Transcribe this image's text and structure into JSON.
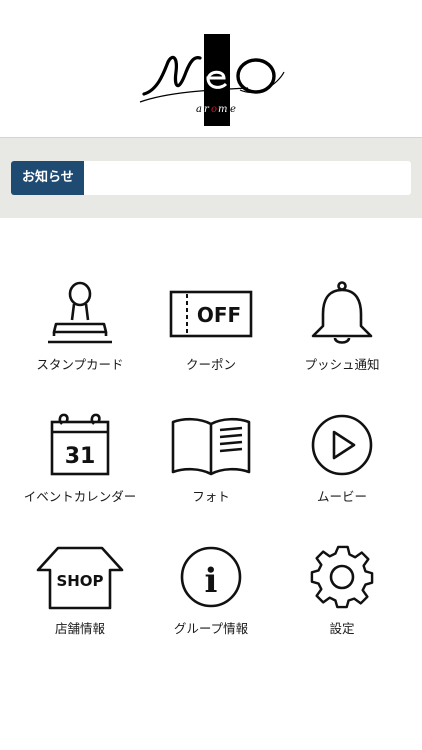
{
  "header": {
    "logo_main": "NeO",
    "logo_sub": "arome"
  },
  "notice": {
    "label": "お知らせ",
    "text": ""
  },
  "menu": [
    {
      "label": "スタンプカード",
      "icon": "stamp-icon"
    },
    {
      "label": "クーポン",
      "icon": "coupon-icon",
      "badge_text": "OFF"
    },
    {
      "label": "プッシュ通知",
      "icon": "bell-icon"
    },
    {
      "label": "イベントカレンダー",
      "icon": "calendar-icon",
      "badge_text": "31"
    },
    {
      "label": "フォト",
      "icon": "photo-book-icon"
    },
    {
      "label": "ムービー",
      "icon": "play-icon"
    },
    {
      "label": "店舗情報",
      "icon": "shop-icon",
      "badge_text": "SHOP"
    },
    {
      "label": "グループ情報",
      "icon": "info-icon",
      "badge_text": "i"
    },
    {
      "label": "設定",
      "icon": "gear-icon"
    }
  ],
  "colors": {
    "notice_label_bg": "#1f4a72",
    "notice_band_bg": "#e8e8e4",
    "icon_stroke": "#111111",
    "logo_accent": "#c8102e"
  }
}
